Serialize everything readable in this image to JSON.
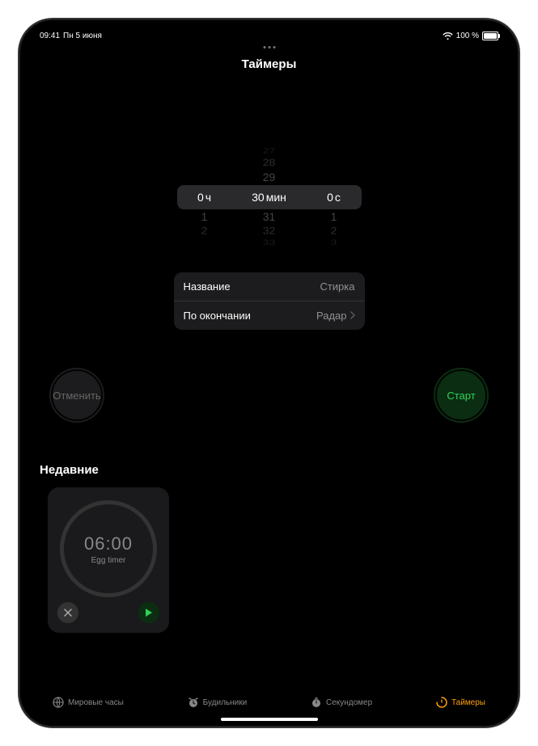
{
  "status": {
    "time": "09:41",
    "date": "Пн 5 июня",
    "battery_pct": "100 %"
  },
  "page": {
    "title": "Таймеры"
  },
  "picker": {
    "hours": {
      "selected": "0",
      "unit": "ч",
      "next": [
        "1",
        "2"
      ]
    },
    "minutes": {
      "selected": "30",
      "unit": "мин",
      "prev": [
        "29",
        "28",
        "27"
      ],
      "next": [
        "31",
        "32",
        "33"
      ]
    },
    "seconds": {
      "selected": "0",
      "unit": "с",
      "next": [
        "1",
        "2",
        "3"
      ]
    }
  },
  "options": {
    "name_label": "Название",
    "name_value": "Стирка",
    "end_label": "По окончании",
    "end_value": "Радар"
  },
  "buttons": {
    "cancel": "Отменить",
    "start": "Старт"
  },
  "recent": {
    "header": "Недавние",
    "items": [
      {
        "time": "06:00",
        "label": "Egg timer"
      }
    ]
  },
  "tabs": {
    "world": "Мировые часы",
    "alarms": "Будильники",
    "stopwatch": "Секундомер",
    "timers": "Таймеры"
  }
}
